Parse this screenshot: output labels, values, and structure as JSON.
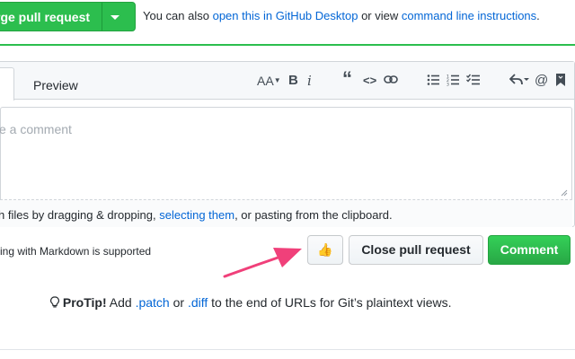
{
  "merge": {
    "button_label": "rge pull request",
    "info_prefix": "You can also ",
    "desktop_link": "open this in GitHub Desktop",
    "info_middle": " or view ",
    "cli_link": "command line instructions",
    "info_suffix": "."
  },
  "editor": {
    "tab_write": "e",
    "tab_preview": "Preview",
    "toolbar_icons": [
      "text-size-icon",
      "bold-icon",
      "italic-icon",
      "quote-icon",
      "code-icon",
      "link-icon",
      "unordered-list-icon",
      "ordered-list-icon",
      "task-list-icon",
      "reply-icon",
      "mention-icon",
      "bookmark-icon"
    ],
    "toolbar_glyphs": {
      "text_size": "AA",
      "bold": "B",
      "italic": "i",
      "quote": "“",
      "code": "<>",
      "mention": "@"
    },
    "placeholder": "e a comment",
    "attach_prefix": "h files by dragging & dropping, ",
    "attach_link": "selecting them",
    "attach_suffix": ", or pasting from the clipboard."
  },
  "footer": {
    "markdown_note": "ing with Markdown is supported",
    "thumb_label": "👍",
    "close_label": "Close pull request",
    "comment_label": "Comment"
  },
  "protip": {
    "bold": "ProTip!",
    "text1": " Add ",
    "link1": ".patch",
    "text2": " or ",
    "link2": ".diff",
    "text3": " to the end of URLs for Git’s plaintext views."
  },
  "colors": {
    "primary_green": "#2cbe4e",
    "link_blue": "#0366d6",
    "arrow_pink": "#f0407a"
  }
}
